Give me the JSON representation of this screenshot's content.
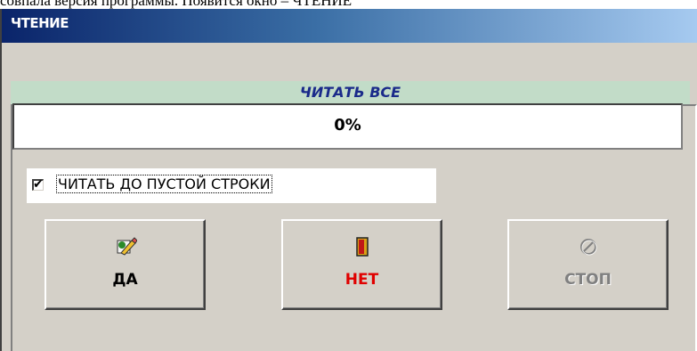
{
  "document": {
    "caption_text": "совпала версия программы. Появится окно – ЧТЕНИЕ"
  },
  "window": {
    "title": "ЧТЕНИЕ"
  },
  "mode": {
    "label": "ЧИТАТЬ ВСЕ"
  },
  "progress": {
    "value_percent": 0,
    "label": "0%"
  },
  "option": {
    "label": "ЧИТАТЬ ДО ПУСТОЙ СТРОКИ",
    "checked": true,
    "checkmark": "✔"
  },
  "buttons": {
    "yes": {
      "label": "ДА",
      "icon": "edit-pencil-icon",
      "glyph": "✎",
      "enabled": true
    },
    "no": {
      "label": "НЕТ",
      "icon": "exit-door-icon",
      "glyph": "▮",
      "enabled": true
    },
    "stop": {
      "label": "СТОП",
      "icon": "stop-no-icon",
      "glyph": "⊘",
      "enabled": false
    }
  },
  "colors": {
    "title_bar_start": "#0a246a",
    "mode_bar_bg": "#c2dcc8",
    "mode_text": "#1a2a8a",
    "no_label": "#e00000",
    "disabled_label": "#808080"
  }
}
